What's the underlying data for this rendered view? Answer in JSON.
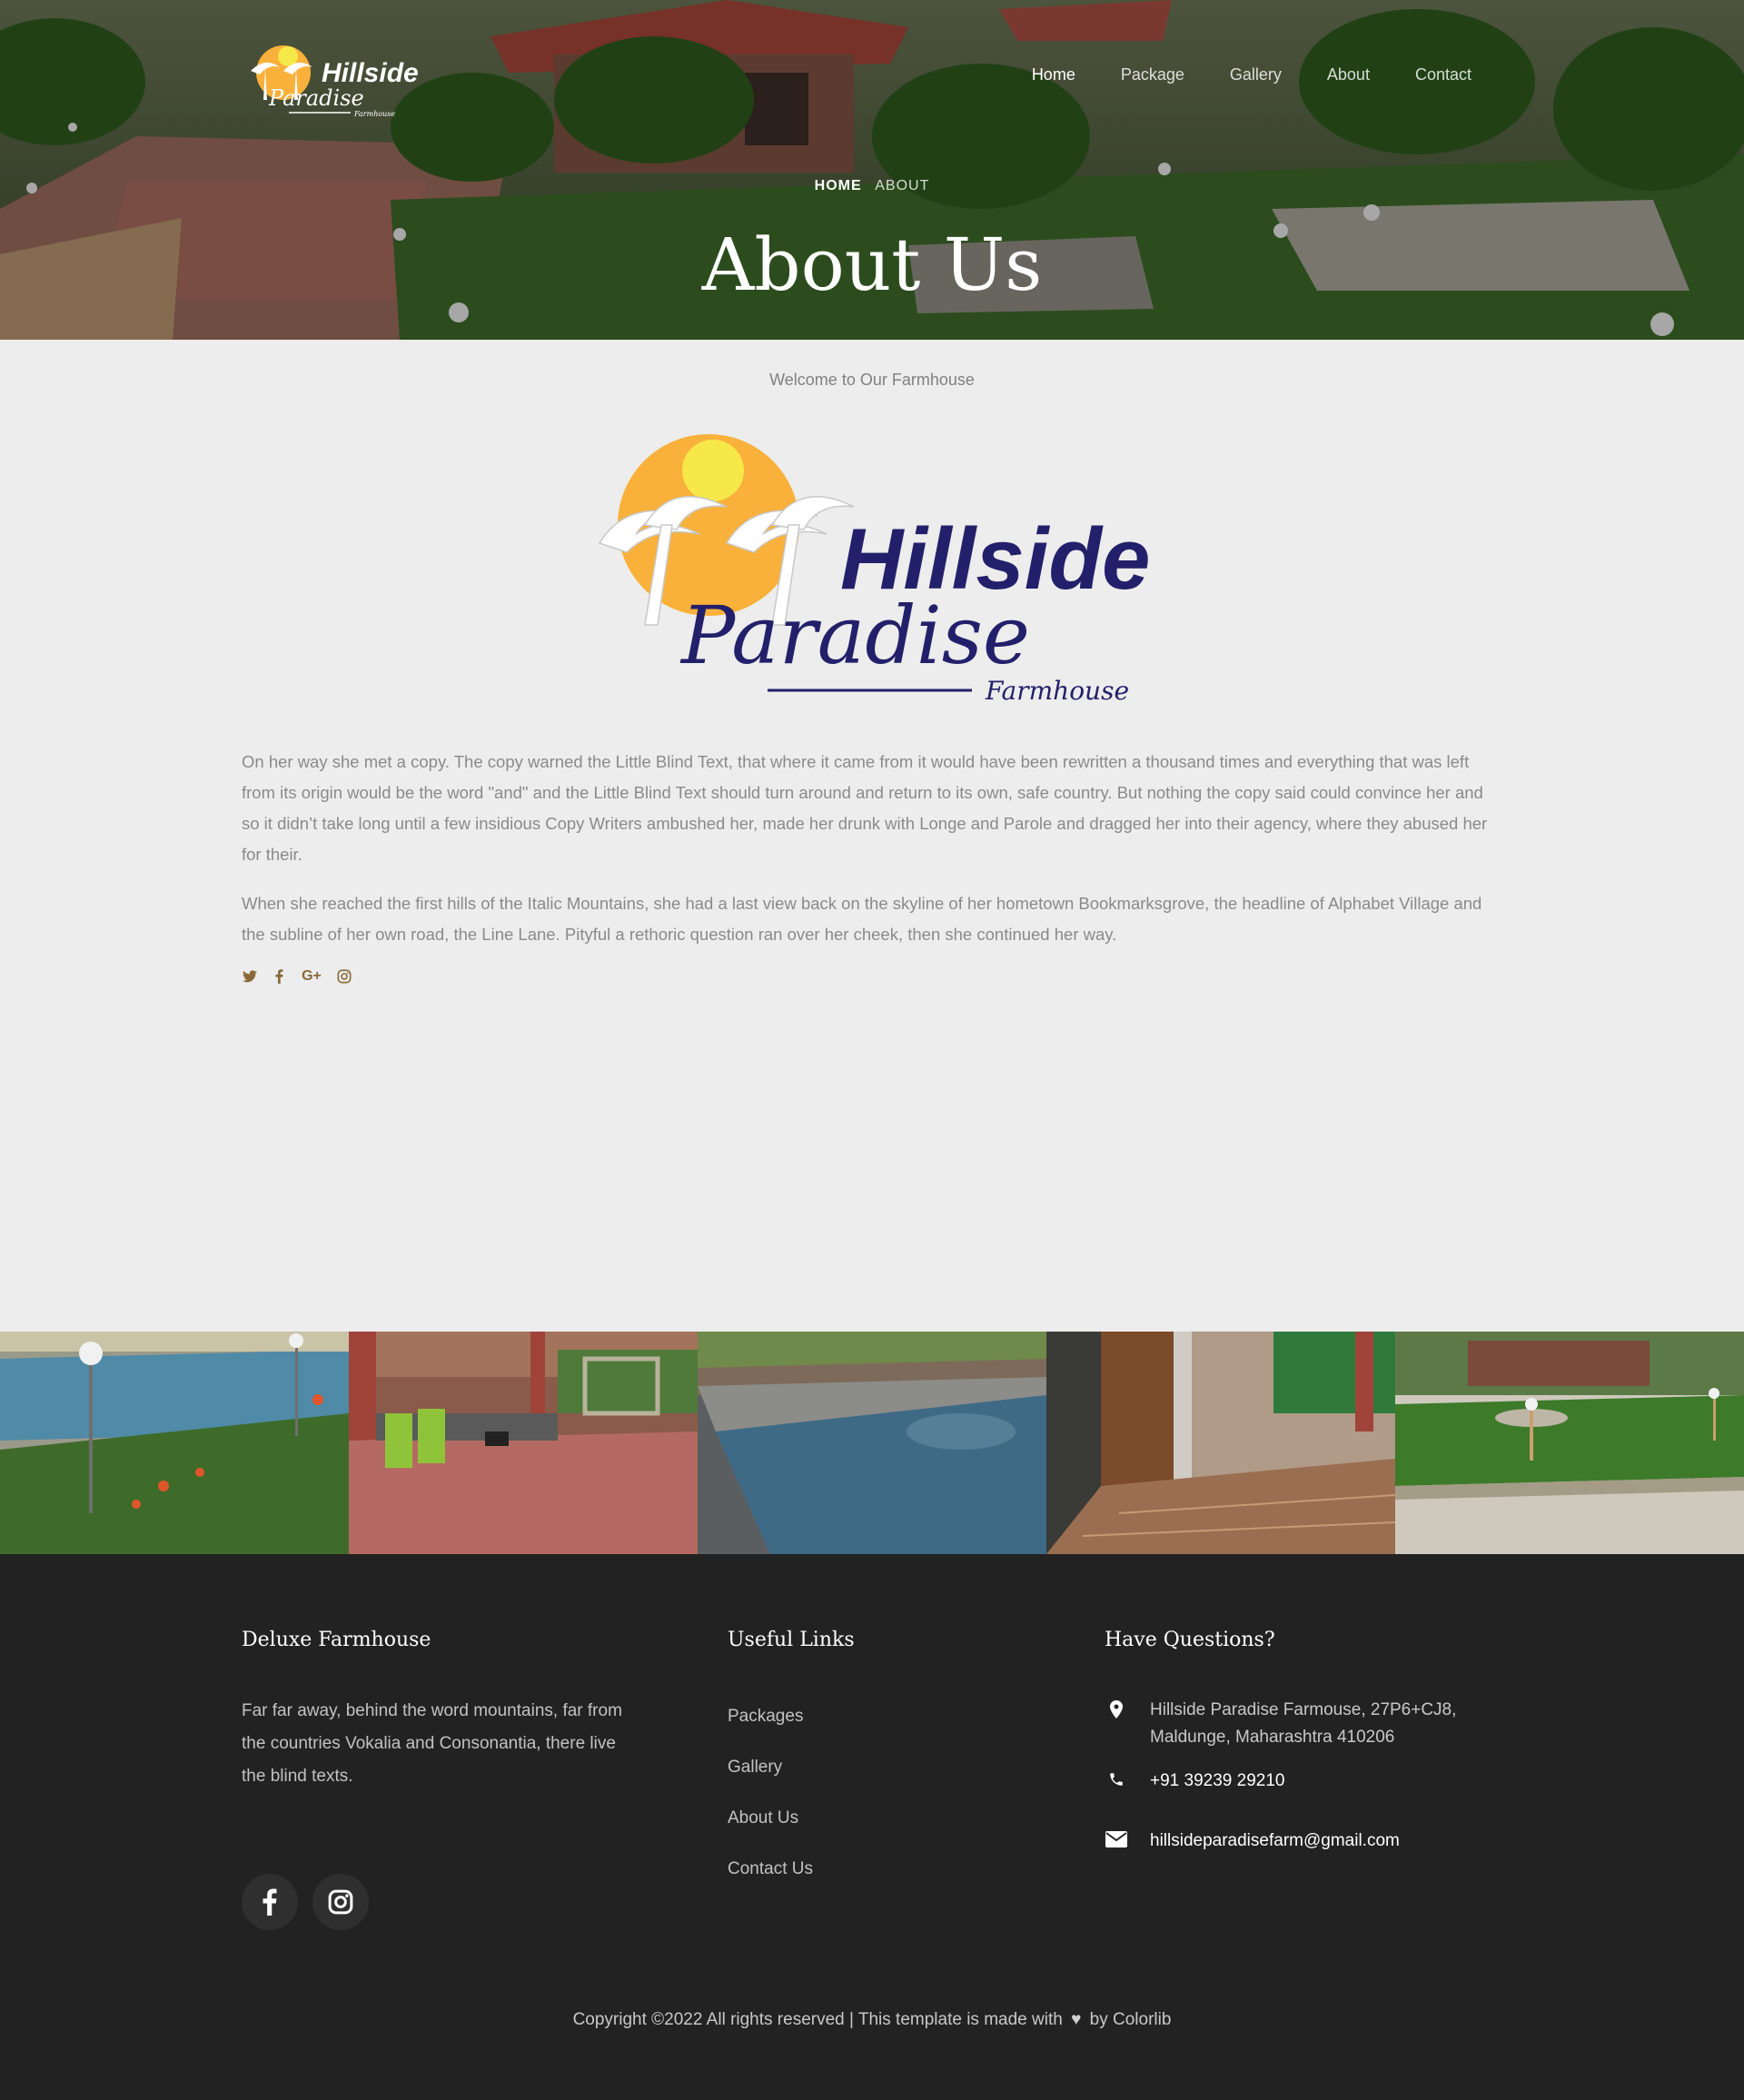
{
  "brand": {
    "name": "Hillside",
    "tagline": "Paradise",
    "sub": "Farmhouse"
  },
  "nav": {
    "items": [
      {
        "label": "Home",
        "active": true
      },
      {
        "label": "Package"
      },
      {
        "label": "Gallery"
      },
      {
        "label": "About"
      },
      {
        "label": "Contact"
      }
    ]
  },
  "hero": {
    "breadcrumb_home": "HOME",
    "breadcrumb_current": "ABOUT",
    "title": "About Us"
  },
  "about": {
    "welcome": "Welcome to Our Farmhouse",
    "paragraphs": [
      "On her way she met a copy. The copy warned the Little Blind Text, that where it came from it would have been rewritten a thousand times and everything that was left from its origin would be the word \"and\" and the Little Blind Text should turn around and return to its own, safe country. But nothing the copy said could convince her and so it didn’t take long until a few insidious Copy Writers ambushed her, made her drunk with Longe and Parole and dragged her into their agency, where they abused her for their.",
      "When she reached the first hills of the Italic Mountains, she had a last view back on the skyline of her hometown Bookmarksgrove, the headline of Alphabet Village and the subline of her own road, the Line Lane. Pityful a rethoric question ran over her cheek, then she continued her way."
    ],
    "social_icons": [
      "twitter-icon",
      "facebook-icon",
      "google-plus-icon",
      "instagram-icon"
    ]
  },
  "gallery": {
    "tiles": [
      "pool-with-garden",
      "patio-with-chairs-and-swing",
      "swimming-pool",
      "veranda-tiled-floor",
      "garden-lawn-cottage"
    ]
  },
  "footer": {
    "col1": {
      "title": "Deluxe Farmhouse",
      "text": "Far far away, behind the word mountains, far from the countries Vokalia and Consonantia, there live the blind texts."
    },
    "col2": {
      "title": "Useful Links",
      "links": [
        "Packages",
        "Gallery",
        "About Us",
        "Contact Us"
      ]
    },
    "col3": {
      "title": "Have Questions?",
      "address": "Hillside Paradise Farmouse, 27P6+CJ8, Maldunge, Maharashtra 410206",
      "phone": "+91 39239 29210",
      "email": "hillsideparadisefarm@gmail.com"
    },
    "copyright_pre": "Copyright ©2022 All rights reserved | This template is made with",
    "copyright_post": "by Colorlib"
  },
  "colors": {
    "brand_navy": "#23206b",
    "sun_orange": "#f9b13b",
    "sun_yellow": "#f7e84a",
    "footer_bg": "#222222",
    "page_bg": "#ecedec"
  }
}
